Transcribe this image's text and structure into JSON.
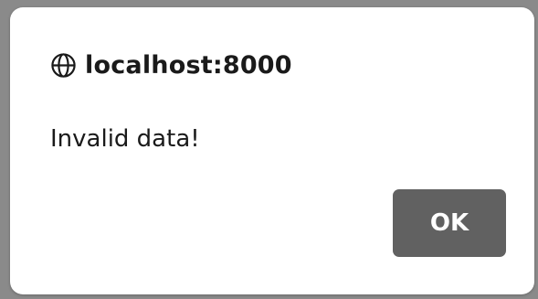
{
  "dialog": {
    "origin_icon": "globe-icon",
    "title": "localhost:8000",
    "message": "Invalid data!",
    "ok_label": "OK"
  },
  "colors": {
    "backdrop": "#8a8a8a",
    "dialog_background": "#ffffff",
    "text": "#1a1a1a",
    "button_background": "#616161",
    "button_text": "#ffffff"
  }
}
